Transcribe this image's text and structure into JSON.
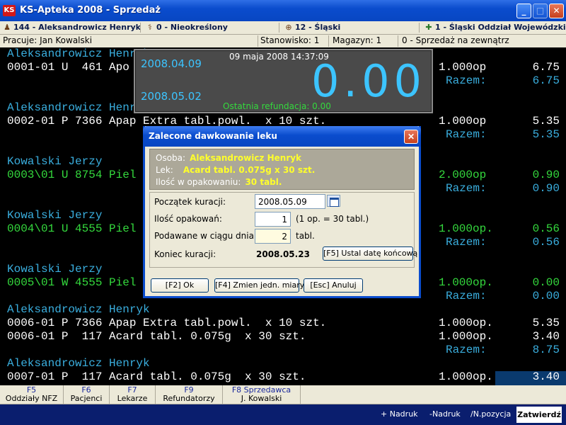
{
  "window": {
    "logo": "KS",
    "title": "KS-Apteka 2008 - Sprzedaż",
    "min": "_",
    "max": "□",
    "close": "✕"
  },
  "infobar": {
    "patient": "144 - Aleksandrowicz Henryk",
    "unspecified": "0 - Nieokreślony",
    "region": "12 - Śląski",
    "branch": "1 - Śląski Oddział Wojewódzki NFZ"
  },
  "statusbar": {
    "worker": "Pracuje: Jan Kowalski",
    "station": "Stanowisko: 1",
    "warehouse": "Magazyn: 1",
    "sale_type": "0 - Sprzedaż na zewnątrz"
  },
  "terminal": {
    "rows": [
      {
        "kind": "name",
        "text": "Aleksandrowicz Henryk"
      },
      {
        "kind": "item",
        "color": "white",
        "text": "0001-01 U  461 Apo",
        "qty": "1.000op",
        "price": "6.75"
      },
      {
        "kind": "razem",
        "label": "Razem:",
        "value": "6.75"
      },
      {
        "kind": "name",
        "text": "Aleksandrowicz Henryk"
      },
      {
        "kind": "item",
        "color": "white",
        "text": "0002-01 P 7366 Apap Extra tabl.powl.  x 10 szt.",
        "qty": "1.000op",
        "price": "5.35"
      },
      {
        "kind": "razem",
        "label": "Razem:",
        "value": "5.35"
      },
      {
        "kind": "name",
        "text": "Kowalski Jerzy"
      },
      {
        "kind": "item",
        "color": "green",
        "text": "0003\\01 U 8754 Piel",
        "qty": "2.000op",
        "price": "0.90"
      },
      {
        "kind": "razem",
        "label": "Razem:",
        "value": "0.90"
      },
      {
        "kind": "name",
        "text": "Kowalski Jerzy"
      },
      {
        "kind": "item",
        "color": "green",
        "text": "0004\\01 U 4555 Piel",
        "qty": "1.000op.",
        "price": "0.56"
      },
      {
        "kind": "razem",
        "label": "Razem:",
        "value": "0.56"
      },
      {
        "kind": "name",
        "text": "Kowalski Jerzy"
      },
      {
        "kind": "item",
        "color": "green",
        "text": "0005\\01 W 4555 Piel",
        "qty": "1.000op.",
        "price": "0.00"
      },
      {
        "kind": "razem",
        "label": "Razem:",
        "value": "0.00"
      },
      {
        "kind": "name",
        "text": "Aleksandrowicz Henryk"
      },
      {
        "kind": "item",
        "color": "white",
        "text": "0006-01 P 7366 Apap Extra tabl.powl.  x 10 szt.",
        "qty": "1.000op.",
        "price": "5.35"
      },
      {
        "kind": "item",
        "color": "white",
        "text": "0006-01 P  117 Acard tabl. 0.075g  x 30 szt.",
        "qty": "1.000op.",
        "price": "3.40"
      },
      {
        "kind": "razem",
        "label": "Razem:",
        "value": "8.75"
      },
      {
        "kind": "name",
        "text": "Aleksandrowicz Henryk"
      },
      {
        "kind": "item",
        "color": "white",
        "text": "0007-01 P  117 Acard tabl. 0.075g  x 30 szt.",
        "qty": "1.000op.",
        "price": "3.40"
      }
    ]
  },
  "display": {
    "date_from": "2008.04.09",
    "date_to": "2008.05.02",
    "datetime": "09 maja 2008  14:37:09",
    "amount": "0.00",
    "last_refund": "Ostatnia refundacja: 0.00"
  },
  "dialog": {
    "title": "Zalecone dawkowanie leku",
    "close": "✕",
    "person_label": "Osoba:",
    "person_value": "Aleksandrowicz Henryk",
    "drug_label": "Lek:",
    "drug_value": "Acard tabl. 0.075g  x 30 szt.",
    "pack_label": "Ilość w opakowaniu:",
    "pack_value": "30 tabl.",
    "start_label": "Początek kuracji:",
    "start_value": "2008.05.09",
    "packages_label": "Ilość opakowań:",
    "packages_value": "1",
    "packages_note": "(1 op. = 30 tabl.)",
    "daily_label": "Podawane w ciągu dnia",
    "daily_value": "2",
    "daily_unit": "tabl.",
    "end_label": "Koniec kuracji:",
    "end_value": "2008.05.23",
    "set_end_btn": "[F5] Ustal datę końcową",
    "ok_btn": "[F2] Ok",
    "change_unit_btn": "[F4] Zmien jedn. miary",
    "cancel_btn": "[Esc] Anuluj"
  },
  "fkeys": [
    {
      "key": "F5",
      "label": "Oddziały NFZ"
    },
    {
      "key": "F6",
      "label": "Pacjenci"
    },
    {
      "key": "F7",
      "label": "Lekarze"
    },
    {
      "key": "F9",
      "label": "Refundatorzy"
    },
    {
      "key": "F8 Sprzedawca",
      "label": "J. Kowalski"
    }
  ],
  "bottombar": {
    "nadruk_plus": "+ Nadruk",
    "nadruk_minus": "-Nadruk",
    "new_position": "/N.pozycja",
    "confirm": "Zatwierdź"
  }
}
